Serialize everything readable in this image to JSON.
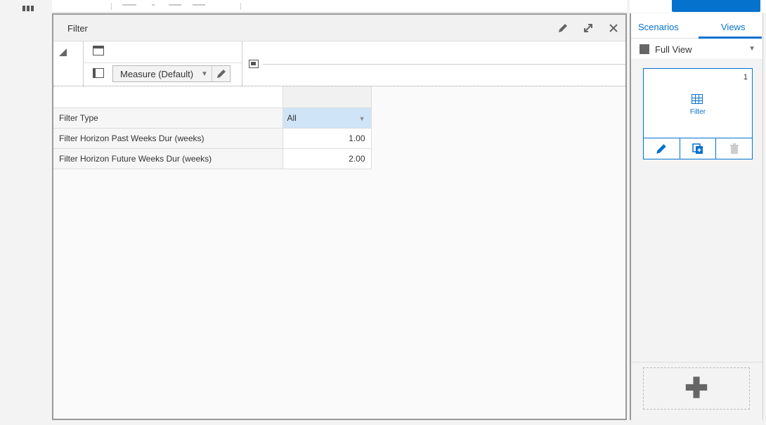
{
  "panel": {
    "title": "Filter",
    "edit_icon": "pencil-icon",
    "expand_icon": "expand-icon",
    "close_icon": "close-icon"
  },
  "pivot": {
    "measure_label": "Measure (Default)"
  },
  "grid": {
    "rows": [
      {
        "name": "Filter Type",
        "value": "All",
        "type": "select"
      },
      {
        "name": "Filter Horizon Past Weeks Dur (weeks)",
        "value": "1.00",
        "type": "number"
      },
      {
        "name": "Filter Horizon Future Weeks Dur (weeks)",
        "value": "2.00",
        "type": "number"
      }
    ]
  },
  "sidebar": {
    "tabs": [
      {
        "label": "Scenarios"
      },
      {
        "label": "Views",
        "active": true
      }
    ],
    "view_select": "Full View",
    "cards": [
      {
        "number": "1",
        "label": "Filter",
        "icon": "table-icon"
      }
    ]
  },
  "colors": {
    "accent": "#0572ce",
    "selected_cell": "#cfe4f7"
  }
}
